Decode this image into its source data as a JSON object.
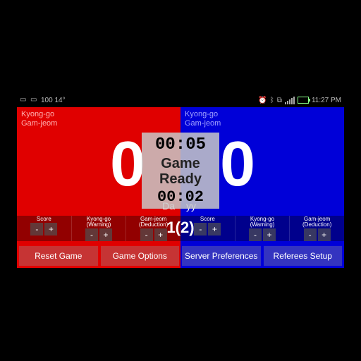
{
  "statusbar": {
    "left_text": "100  14°",
    "time": "11:27 PM"
  },
  "penalty_labels": {
    "kyonggo": "Kyong-go",
    "gamjeom": "Gam-jeom"
  },
  "red": {
    "score": "0",
    "name": "Da"
  },
  "blue": {
    "score": "0",
    "name": "yy"
  },
  "center": {
    "timer_main": "00:05",
    "status_line1": "Game",
    "status_line2": "Ready",
    "timer_sub": "00:02",
    "round": "1(2)"
  },
  "controls": {
    "score": "Score",
    "kyonggo": "Kyong-go",
    "kyonggo_sub": "(Warning)",
    "gamjeom": "Gam-jeom",
    "gamjeom_sub": "(Deduction)",
    "minus": "-",
    "plus": "+"
  },
  "buttons": {
    "reset": "Reset Game",
    "options": "Game Options",
    "server": "Server Preferences",
    "referees": "Referees Setup"
  }
}
